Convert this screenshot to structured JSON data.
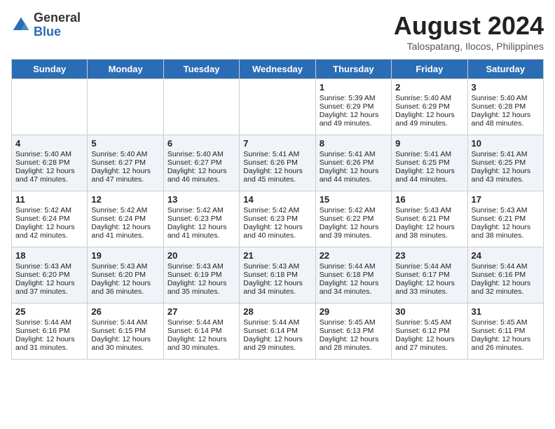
{
  "header": {
    "logo_general": "General",
    "logo_blue": "Blue",
    "month_title": "August 2024",
    "subtitle": "Talospatang, Ilocos, Philippines"
  },
  "days_of_week": [
    "Sunday",
    "Monday",
    "Tuesday",
    "Wednesday",
    "Thursday",
    "Friday",
    "Saturday"
  ],
  "weeks": [
    [
      {
        "day": "",
        "info": ""
      },
      {
        "day": "",
        "info": ""
      },
      {
        "day": "",
        "info": ""
      },
      {
        "day": "",
        "info": ""
      },
      {
        "day": "1",
        "info": "Sunrise: 5:39 AM\nSunset: 6:29 PM\nDaylight: 12 hours\nand 49 minutes."
      },
      {
        "day": "2",
        "info": "Sunrise: 5:40 AM\nSunset: 6:29 PM\nDaylight: 12 hours\nand 49 minutes."
      },
      {
        "day": "3",
        "info": "Sunrise: 5:40 AM\nSunset: 6:28 PM\nDaylight: 12 hours\nand 48 minutes."
      }
    ],
    [
      {
        "day": "4",
        "info": "Sunrise: 5:40 AM\nSunset: 6:28 PM\nDaylight: 12 hours\nand 47 minutes."
      },
      {
        "day": "5",
        "info": "Sunrise: 5:40 AM\nSunset: 6:27 PM\nDaylight: 12 hours\nand 47 minutes."
      },
      {
        "day": "6",
        "info": "Sunrise: 5:40 AM\nSunset: 6:27 PM\nDaylight: 12 hours\nand 46 minutes."
      },
      {
        "day": "7",
        "info": "Sunrise: 5:41 AM\nSunset: 6:26 PM\nDaylight: 12 hours\nand 45 minutes."
      },
      {
        "day": "8",
        "info": "Sunrise: 5:41 AM\nSunset: 6:26 PM\nDaylight: 12 hours\nand 44 minutes."
      },
      {
        "day": "9",
        "info": "Sunrise: 5:41 AM\nSunset: 6:25 PM\nDaylight: 12 hours\nand 44 minutes."
      },
      {
        "day": "10",
        "info": "Sunrise: 5:41 AM\nSunset: 6:25 PM\nDaylight: 12 hours\nand 43 minutes."
      }
    ],
    [
      {
        "day": "11",
        "info": "Sunrise: 5:42 AM\nSunset: 6:24 PM\nDaylight: 12 hours\nand 42 minutes."
      },
      {
        "day": "12",
        "info": "Sunrise: 5:42 AM\nSunset: 6:24 PM\nDaylight: 12 hours\nand 41 minutes."
      },
      {
        "day": "13",
        "info": "Sunrise: 5:42 AM\nSunset: 6:23 PM\nDaylight: 12 hours\nand 41 minutes."
      },
      {
        "day": "14",
        "info": "Sunrise: 5:42 AM\nSunset: 6:23 PM\nDaylight: 12 hours\nand 40 minutes."
      },
      {
        "day": "15",
        "info": "Sunrise: 5:42 AM\nSunset: 6:22 PM\nDaylight: 12 hours\nand 39 minutes."
      },
      {
        "day": "16",
        "info": "Sunrise: 5:43 AM\nSunset: 6:21 PM\nDaylight: 12 hours\nand 38 minutes."
      },
      {
        "day": "17",
        "info": "Sunrise: 5:43 AM\nSunset: 6:21 PM\nDaylight: 12 hours\nand 38 minutes."
      }
    ],
    [
      {
        "day": "18",
        "info": "Sunrise: 5:43 AM\nSunset: 6:20 PM\nDaylight: 12 hours\nand 37 minutes."
      },
      {
        "day": "19",
        "info": "Sunrise: 5:43 AM\nSunset: 6:20 PM\nDaylight: 12 hours\nand 36 minutes."
      },
      {
        "day": "20",
        "info": "Sunrise: 5:43 AM\nSunset: 6:19 PM\nDaylight: 12 hours\nand 35 minutes."
      },
      {
        "day": "21",
        "info": "Sunrise: 5:43 AM\nSunset: 6:18 PM\nDaylight: 12 hours\nand 34 minutes."
      },
      {
        "day": "22",
        "info": "Sunrise: 5:44 AM\nSunset: 6:18 PM\nDaylight: 12 hours\nand 34 minutes."
      },
      {
        "day": "23",
        "info": "Sunrise: 5:44 AM\nSunset: 6:17 PM\nDaylight: 12 hours\nand 33 minutes."
      },
      {
        "day": "24",
        "info": "Sunrise: 5:44 AM\nSunset: 6:16 PM\nDaylight: 12 hours\nand 32 minutes."
      }
    ],
    [
      {
        "day": "25",
        "info": "Sunrise: 5:44 AM\nSunset: 6:16 PM\nDaylight: 12 hours\nand 31 minutes."
      },
      {
        "day": "26",
        "info": "Sunrise: 5:44 AM\nSunset: 6:15 PM\nDaylight: 12 hours\nand 30 minutes."
      },
      {
        "day": "27",
        "info": "Sunrise: 5:44 AM\nSunset: 6:14 PM\nDaylight: 12 hours\nand 30 minutes."
      },
      {
        "day": "28",
        "info": "Sunrise: 5:44 AM\nSunset: 6:14 PM\nDaylight: 12 hours\nand 29 minutes."
      },
      {
        "day": "29",
        "info": "Sunrise: 5:45 AM\nSunset: 6:13 PM\nDaylight: 12 hours\nand 28 minutes."
      },
      {
        "day": "30",
        "info": "Sunrise: 5:45 AM\nSunset: 6:12 PM\nDaylight: 12 hours\nand 27 minutes."
      },
      {
        "day": "31",
        "info": "Sunrise: 5:45 AM\nSunset: 6:11 PM\nDaylight: 12 hours\nand 26 minutes."
      }
    ]
  ]
}
